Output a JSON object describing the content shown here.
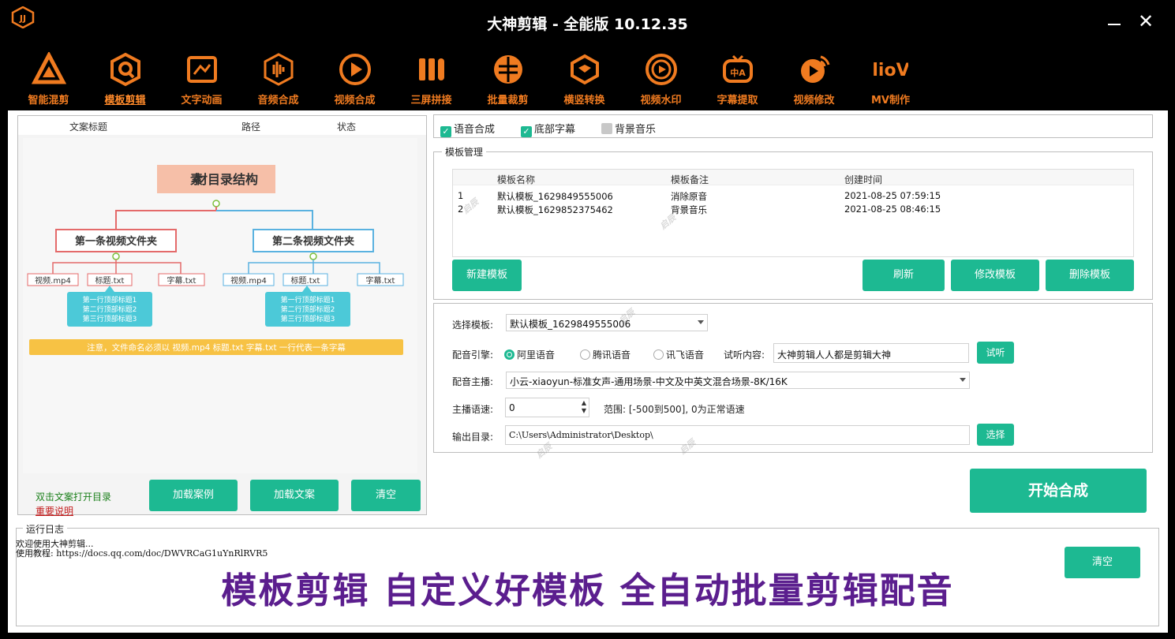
{
  "app": {
    "title": "大神剪辑 - 全能版 10.12.35",
    "logo_icon": "app-logo-icon",
    "accent_color": "#f07b20",
    "button_color": "#1db992"
  },
  "toolbar": {
    "items": [
      {
        "label": "智能混剪",
        "icon": "triangle-logo-icon",
        "active": false
      },
      {
        "label": "模板剪辑",
        "icon": "hexagon-q-icon",
        "active": true
      },
      {
        "label": "文字动画",
        "icon": "image-frame-icon",
        "active": false
      },
      {
        "label": "音频合成",
        "icon": "audio-hexagon-icon",
        "active": false
      },
      {
        "label": "视频合成",
        "icon": "video-play-icon",
        "active": false
      },
      {
        "label": "三屏拼接",
        "icon": "three-bars-icon",
        "active": false
      },
      {
        "label": "批量裁剪",
        "icon": "crop-circle-icon",
        "active": false
      },
      {
        "label": "横竖转换",
        "icon": "rotate-cube-icon",
        "active": false
      },
      {
        "label": "视频水印",
        "icon": "watermark-play-icon",
        "active": false
      },
      {
        "label": "字幕提取",
        "icon": "subtitle-tv-icon",
        "active": false
      },
      {
        "label": "视频修改",
        "icon": "video-edit-icon",
        "active": false
      },
      {
        "label": "MV制作",
        "icon": "mv-logo-icon",
        "active": false
      }
    ]
  },
  "left_panel": {
    "columns": [
      "文案标题",
      "路径",
      "状态"
    ],
    "diagram": {
      "title": "材目录结构",
      "folder1": "第一条视频文件夹",
      "folder2": "第二条视频文件夹",
      "files": [
        "视频.mp4",
        "标题.txt",
        "字幕.txt"
      ],
      "note_lines": [
        "第一行顶部标题1",
        "第二行顶部标题2",
        "第三行顶部标题3"
      ],
      "notice": "注意，文件命名必须以 视频.mp4 标题.txt 字幕.txt 一行代表一条字幕"
    },
    "link_open": "双击文案打开目录",
    "link_help": "重要说明",
    "buttons": {
      "load_case": "加载案例",
      "load_text": "加载文案",
      "clear": "清空"
    }
  },
  "options": {
    "voice": {
      "label": "语音合成",
      "checked": true
    },
    "subtitle": {
      "label": "底部字幕",
      "checked": true
    },
    "bgm": {
      "label": "背景音乐",
      "checked": false
    }
  },
  "template_mgmt": {
    "title": "模板管理",
    "headers": [
      "模板名称",
      "模板备注",
      "创建时间"
    ],
    "rows": [
      {
        "idx": "1",
        "name": "默认模板_1629849555006",
        "note": "消除原音",
        "time": "2021-08-25 07:59:15"
      },
      {
        "idx": "2",
        "name": "默认模板_1629852375462",
        "note": "背景音乐",
        "time": "2021-08-25 08:46:15"
      }
    ],
    "buttons": {
      "new": "新建模板",
      "refresh": "刷新",
      "edit": "修改模板",
      "delete": "删除模板"
    }
  },
  "settings": {
    "template_label": "选择模板:",
    "template_value": "默认模板_1629849555006",
    "engine_label": "配音引擎:",
    "engines": [
      {
        "label": "阿里语音",
        "selected": true
      },
      {
        "label": "腾讯语音",
        "selected": false
      },
      {
        "label": "讯飞语音",
        "selected": false
      }
    ],
    "listen_label": "试听内容:",
    "listen_value": "大神剪辑人人都是剪辑大神",
    "listen_button": "试听",
    "anchor_label": "配音主播:",
    "anchor_value": "小云-xiaoyun-标准女声-通用场景-中文及中英文混合场景-8K/16K",
    "speed_label": "主播语速:",
    "speed_value": "0",
    "speed_hint": "范围: [-500到500], 0为正常语速",
    "output_label": "输出目录:",
    "output_value": "C:\\Users\\Administrator\\Desktop\\",
    "output_button": "选择"
  },
  "start_button": "开始合成",
  "log": {
    "title": "运行日志",
    "line1": "欢迎使用大神剪辑...",
    "line2": "使用教程: https://docs.qq.com/doc/DWVRCaG1uYnRlRVR5",
    "clear_button": "清空"
  },
  "banner": "模板剪辑 自定义好模板 全自动批量剪辑配音",
  "watermark": "启辰"
}
